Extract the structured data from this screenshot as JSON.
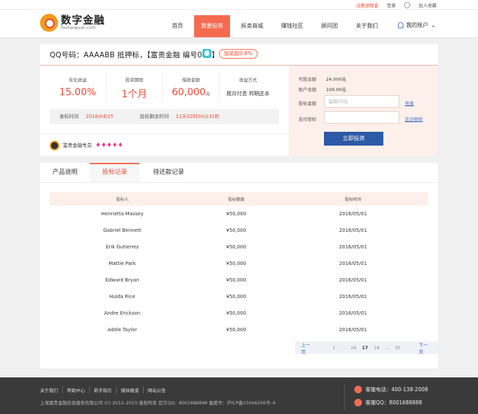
{
  "topbar": {
    "register": "注册送现金",
    "login": "登录",
    "join_qq": "加入收藏"
  },
  "brand": {
    "name_cn": "数字金融",
    "domain": "fouhaoquan.com"
  },
  "nav": {
    "items": [
      "首页",
      "我要投资",
      "拆卖商城",
      "赚钱社区",
      "顾问团",
      "关于我们"
    ],
    "active": "我要投资",
    "account": "我的账户"
  },
  "loan": {
    "title": "QQ号码：AAAABB 抵押标，【富贵金融 编号017】",
    "bonus": "加奖励0.8%",
    "stats": [
      {
        "label": "年化收益",
        "value": "15.00%"
      },
      {
        "label": "投资期限",
        "value": "1个月"
      },
      {
        "label": "借款金额",
        "value": "60,000",
        "unit": "元"
      },
      {
        "label": "收益方式",
        "value": "按月付息 到期还本"
      }
    ],
    "publish_label": "发标时间",
    "publish_value": "2016/04/25",
    "remain_label": "投标剩余时间",
    "remain_value": "12天02时00分31秒",
    "expert_label": "富贵金融专员",
    "expert_gems": "♦♦♦♦♦"
  },
  "invest": {
    "available_label": "可投余额",
    "available_value": "24,000元",
    "balance_label": "账户余额",
    "balance_value": "100.00元",
    "amount_label": "投标金额",
    "amount_placeholder": "起投50元",
    "recharge": "充值",
    "password_label": "支付密码",
    "password_placeholder": "",
    "forgot": "忘记密码",
    "submit": "立即投资"
  },
  "tabs": [
    "产品说明",
    "投标记录",
    "待还款记录"
  ],
  "records": {
    "headers": [
      "投标人",
      "投标额度",
      "投标时间"
    ],
    "rows": [
      [
        "Henrietta Massey",
        "¥50,000",
        "2016/05/01"
      ],
      [
        "Gabriel Bennett",
        "¥50,000",
        "2016/05/01"
      ],
      [
        "Erik Gutierrez",
        "¥50,000",
        "2016/05/01"
      ],
      [
        "Mattie Park",
        "¥50,000",
        "2016/05/01"
      ],
      [
        "Edward Bryan",
        "¥50,000",
        "2016/05/01"
      ],
      [
        "Hulda Rice",
        "¥50,000",
        "2016/05/01"
      ],
      [
        "Andre Erickson",
        "¥50,000",
        "2016/05/01"
      ],
      [
        "Addie Taylor",
        "¥50,000",
        "2016/05/01"
      ]
    ]
  },
  "pager": {
    "prev": "上一页",
    "pages": [
      "1",
      "...",
      "16",
      "17",
      "18",
      "...",
      "35"
    ],
    "current": "17",
    "next": "下一页"
  },
  "footer": {
    "links": [
      "关于我们",
      "帮助中心",
      "新手指引",
      "媒体报道",
      "网站公告"
    ],
    "copyright": "上海富贵金融信息服务有限公司 (C) 2012–2015 版权所有   官方QQ：8001688888 备案号：沪ICP备15046256号–4",
    "phone": "客服电话：400-138-2008",
    "qq": "客服QQ：8001688888"
  },
  "colors": {
    "accent": "#f56b50",
    "highlight": "#e94a35",
    "button": "#2d5aa6",
    "footer": "#3a3a3a"
  }
}
